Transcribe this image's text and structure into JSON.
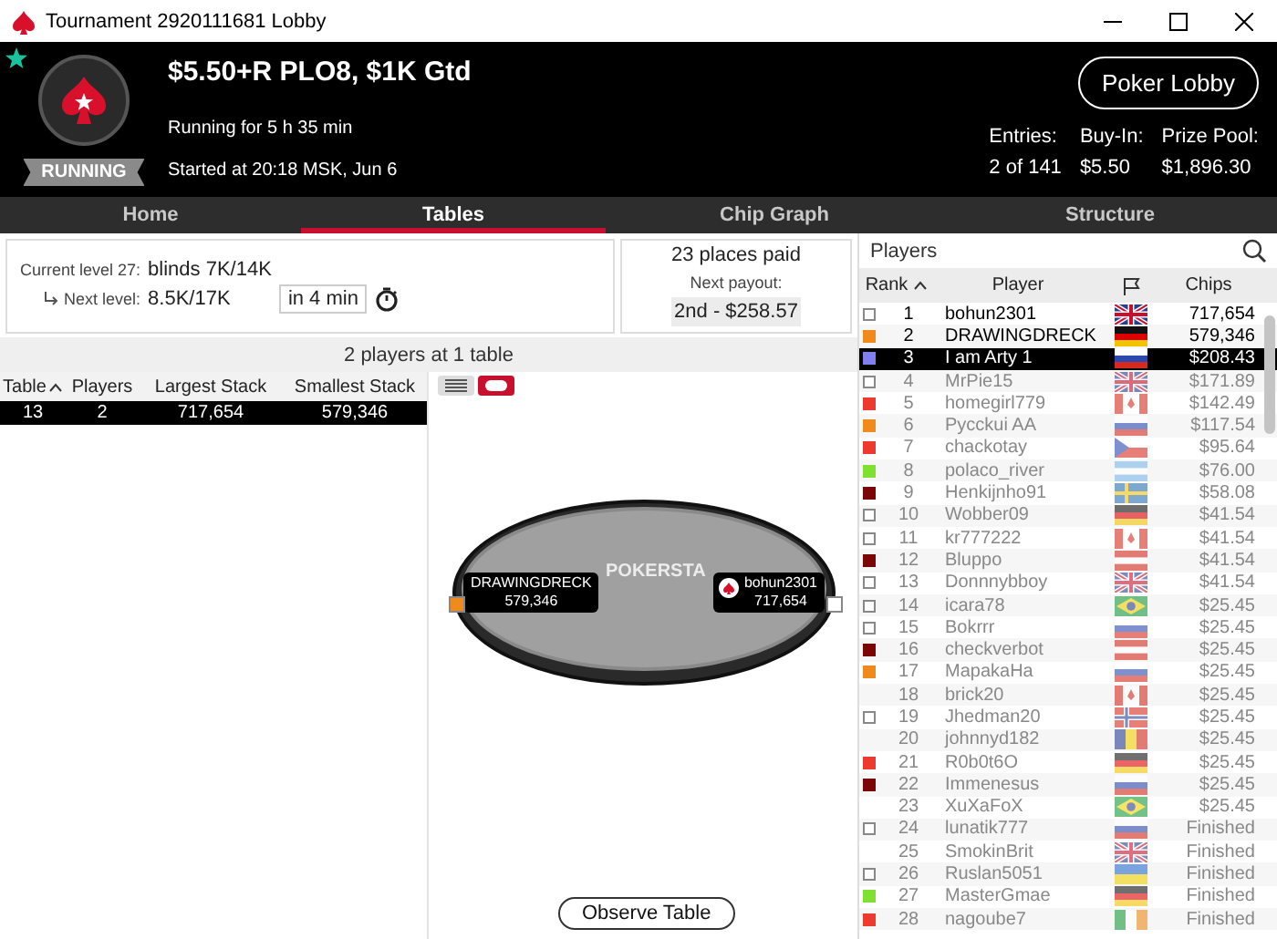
{
  "window": {
    "title": "Tournament 2920111681 Lobby"
  },
  "header": {
    "favorite": true,
    "status": "RUNNING",
    "name": "$5.50+R PLO8, $1K Gtd",
    "running_for": "Running for 5 h 35 min",
    "started": "Started at 20:18 MSK, Jun 6",
    "lobby_button": "Poker Lobby",
    "stats": [
      {
        "label": "Entries:",
        "value": "2 of 141"
      },
      {
        "label": "Buy-In:",
        "value": "$5.50"
      },
      {
        "label": "Prize Pool:",
        "value": "$1,896.30"
      }
    ]
  },
  "tabs": [
    {
      "label": "Home",
      "selected": false
    },
    {
      "label": "Tables",
      "selected": true
    },
    {
      "label": "Chip Graph",
      "selected": false
    },
    {
      "label": "Structure",
      "selected": false
    }
  ],
  "level": {
    "current_label": "Current level 27:",
    "current_value": "blinds 7K/14K",
    "next_label": "Next level:",
    "next_value": "8.5K/17K",
    "next_in": "in 4 min"
  },
  "payout": {
    "places": "23 places paid",
    "next_label": "Next payout:",
    "next_value": "2nd - $258.57"
  },
  "tables": {
    "summary": "2 players at 1 table",
    "columns": [
      "Table",
      "Players",
      "Largest Stack",
      "Smallest Stack"
    ],
    "rows": [
      {
        "cells": [
          "13",
          "2",
          "717,654",
          "579,346"
        ],
        "selected": true
      }
    ]
  },
  "view_modes": [
    {
      "kind": "list",
      "selected": false
    },
    {
      "kind": "table",
      "selected": true
    }
  ],
  "table_view": {
    "logo": "POKERSTA",
    "seats": [
      {
        "name": "DRAWINGDRECK",
        "chips": "579,346",
        "color": "#f08a1a",
        "dealer": false
      },
      {
        "name": "bohun2301",
        "chips": "717,654",
        "color": "#ffffff",
        "dealer": true
      }
    ],
    "button": "Observe Table"
  },
  "players": {
    "title": "Players",
    "columns": [
      "Rank",
      "Player",
      "Chips"
    ],
    "rows": [
      {
        "rank": "1",
        "name": "bohun2301",
        "flag": {
          "kind": "gb"
        },
        "chips": "717,654",
        "box": true,
        "active": true,
        "selected": false
      },
      {
        "rank": "2",
        "name": "DRAWINGDRECK",
        "flag": {
          "kind": "de"
        },
        "chips": "579,346",
        "box": true,
        "color": "#f08a1a",
        "active": true,
        "selected": false
      },
      {
        "rank": "3",
        "name": "I am Arty 1",
        "flag": {
          "kind": "ru"
        },
        "chips": "$208.43",
        "box": true,
        "color": "#7f7ff0",
        "active": true,
        "selected": true
      },
      {
        "rank": "4",
        "name": "MrPie15",
        "flag": {
          "kind": "gb"
        },
        "chips": "$171.89",
        "box": true,
        "active": false,
        "selected": false
      },
      {
        "rank": "5",
        "name": "homegirl779",
        "flag": {
          "kind": "ca"
        },
        "chips": "$142.49",
        "box": true,
        "color": "#ee3a2e",
        "active": false,
        "selected": false
      },
      {
        "rank": "6",
        "name": "Pycckui AA",
        "flag": {
          "kind": "ru"
        },
        "chips": "$117.54",
        "box": true,
        "color": "#f08a1a",
        "active": false,
        "selected": false
      },
      {
        "rank": "7",
        "name": "chackotay",
        "flag": {
          "kind": "cz"
        },
        "chips": "$95.64",
        "box": true,
        "color": "#ee3a2e",
        "active": false,
        "selected": false
      },
      {
        "rank": "8",
        "name": "polaco_river",
        "flag": {
          "kind": "ar"
        },
        "chips": "$76.00",
        "box": true,
        "color": "#80e030",
        "active": false,
        "selected": false
      },
      {
        "rank": "9",
        "name": "Henkijnho91",
        "flag": {
          "kind": "se"
        },
        "chips": "$58.08",
        "box": true,
        "color": "#7a0606",
        "active": false,
        "selected": false
      },
      {
        "rank": "10",
        "name": "Wobber09",
        "flag": {
          "kind": "de"
        },
        "chips": "$41.54",
        "box": true,
        "active": false,
        "selected": false
      },
      {
        "rank": "11",
        "name": "kr777222",
        "flag": {
          "kind": "ca"
        },
        "chips": "$41.54",
        "box": true,
        "active": false,
        "selected": false
      },
      {
        "rank": "12",
        "name": "Bluppo",
        "flag": {
          "kind": "at"
        },
        "chips": "$41.54",
        "box": true,
        "color": "#7a0606",
        "active": false,
        "selected": false
      },
      {
        "rank": "13",
        "name": "Donnnybboy",
        "flag": {
          "kind": "gb"
        },
        "chips": "$41.54",
        "box": true,
        "active": false,
        "selected": false
      },
      {
        "rank": "14",
        "name": "icara78",
        "flag": {
          "kind": "br"
        },
        "chips": "$25.45",
        "box": true,
        "active": false,
        "selected": false
      },
      {
        "rank": "15",
        "name": "Bokrrr",
        "flag": {
          "kind": "ru"
        },
        "chips": "$25.45",
        "box": true,
        "active": false,
        "selected": false
      },
      {
        "rank": "16",
        "name": "checkverbot",
        "flag": {
          "kind": "at"
        },
        "chips": "$25.45",
        "box": true,
        "color": "#7a0606",
        "active": false,
        "selected": false
      },
      {
        "rank": "17",
        "name": "MapakaHa",
        "flag": {
          "kind": "ru"
        },
        "chips": "$25.45",
        "box": true,
        "color": "#f08a1a",
        "active": false,
        "selected": false
      },
      {
        "rank": "18",
        "name": "brick20",
        "flag": {
          "kind": "ca"
        },
        "chips": "$25.45",
        "box": false,
        "active": false,
        "selected": false
      },
      {
        "rank": "19",
        "name": "Jhedman20",
        "flag": {
          "kind": "no"
        },
        "chips": "$25.45",
        "box": true,
        "active": false,
        "selected": false
      },
      {
        "rank": "20",
        "name": "johnnyd182",
        "flag": {
          "kind": "ro"
        },
        "chips": "$25.45",
        "box": false,
        "active": false,
        "selected": false
      },
      {
        "rank": "21",
        "name": "R0b0t6O",
        "flag": {
          "kind": "de"
        },
        "chips": "$25.45",
        "box": true,
        "color": "#ee3a2e",
        "active": false,
        "selected": false
      },
      {
        "rank": "22",
        "name": "Immenesus",
        "flag": {
          "kind": "ru"
        },
        "chips": "$25.45",
        "box": true,
        "color": "#7a0606",
        "active": false,
        "selected": false
      },
      {
        "rank": "23",
        "name": "XuXaFoX",
        "flag": {
          "kind": "br"
        },
        "chips": "$25.45",
        "box": false,
        "active": false,
        "selected": false
      },
      {
        "rank": "24",
        "name": "lunatik777",
        "flag": {
          "kind": "ru"
        },
        "chips": "Finished",
        "box": true,
        "active": false,
        "selected": false
      },
      {
        "rank": "25",
        "name": "SmokinBrit",
        "flag": {
          "kind": "gb"
        },
        "chips": "Finished",
        "box": false,
        "active": false,
        "selected": false
      },
      {
        "rank": "26",
        "name": "Ruslan5051",
        "flag": {
          "kind": "ua"
        },
        "chips": "Finished",
        "box": true,
        "active": false,
        "selected": false
      },
      {
        "rank": "27",
        "name": "MasterGmae",
        "flag": {
          "kind": "de"
        },
        "chips": "Finished",
        "box": true,
        "color": "#80e030",
        "active": false,
        "selected": false
      },
      {
        "rank": "28",
        "name": "nagoube7",
        "flag": {
          "kind": "ie"
        },
        "chips": "Finished",
        "box": true,
        "color": "#ee3a2e",
        "active": false,
        "selected": false
      }
    ]
  }
}
